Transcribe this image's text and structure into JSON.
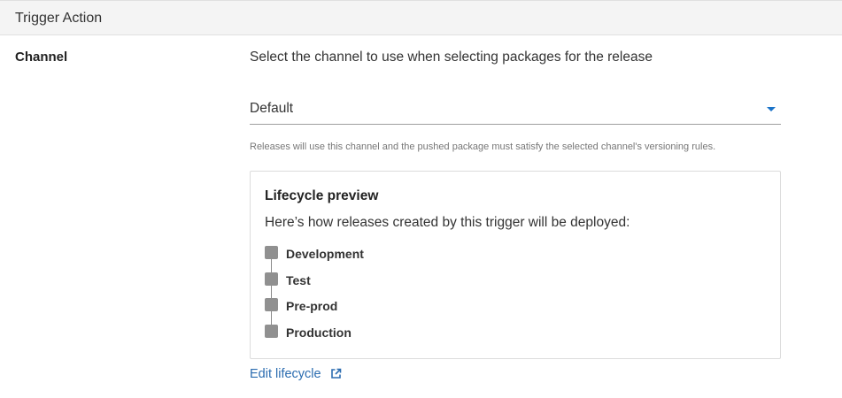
{
  "section": {
    "title": "Trigger Action"
  },
  "channel": {
    "label": "Channel",
    "description": "Select the channel to use when selecting packages for the release",
    "selected": "Default",
    "help_text": "Releases will use this channel and the pushed package must satisfy the selected channel's versioning rules."
  },
  "lifecycle_preview": {
    "title": "Lifecycle preview",
    "subtitle": "Here’s how releases created by this trigger will be deployed:",
    "phases": [
      {
        "name": "Development"
      },
      {
        "name": "Test"
      },
      {
        "name": "Pre-prod"
      },
      {
        "name": "Production"
      }
    ]
  },
  "edit_link": {
    "label": "Edit lifecycle",
    "icon": "external-link-icon"
  },
  "colors": {
    "accent": "#1a73c8",
    "link": "#2b6cb0",
    "phase_dot": "#909090",
    "header_bg": "#f4f4f4"
  }
}
